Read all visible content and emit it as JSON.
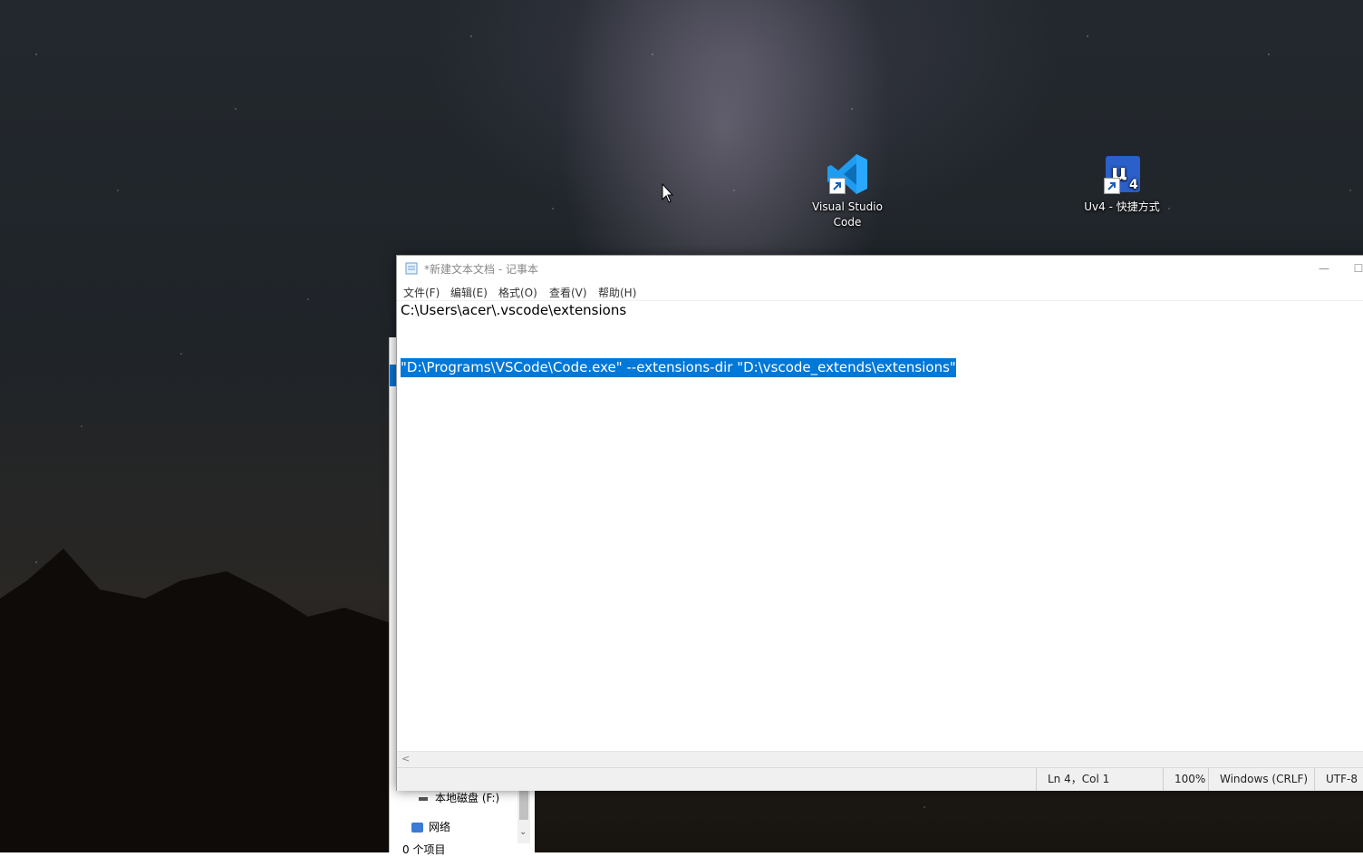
{
  "desktop": {
    "icons": [
      {
        "label": "Visual Studio Code",
        "icon": "vscode-icon"
      },
      {
        "label": "Uv4 - 快捷方式",
        "icon": "keil-uv4-icon"
      }
    ]
  },
  "explorer": {
    "drive_label": "本地磁盘 (F:)",
    "network_label": "网络",
    "item_count": "0 个项目"
  },
  "notepad": {
    "title": "*新建文本文档 - 记事本",
    "menus": [
      "文件(F)",
      "编辑(E)",
      "格式(O)",
      "查看(V)",
      "帮助(H)"
    ],
    "lines": [
      "C:\\Users\\acer\\.vscode\\extensions",
      "",
      "",
      "\"D:\\Programs\\VSCode\\Code.exe\" --extensions-dir \"D:\\vscode_extends\\extensions\""
    ],
    "selected_line_index": 3,
    "status": {
      "position": "Ln 4，Col 1",
      "zoom": "100%",
      "line_ending": "Windows (CRLF)",
      "encoding": "UTF-8"
    },
    "window_buttons": {
      "minimize": "—",
      "maximize": "☐"
    }
  },
  "colors": {
    "selection": "#0078d7",
    "vscode_blue": "#1f9cf0",
    "keil_blue": "#2b5fc9"
  }
}
